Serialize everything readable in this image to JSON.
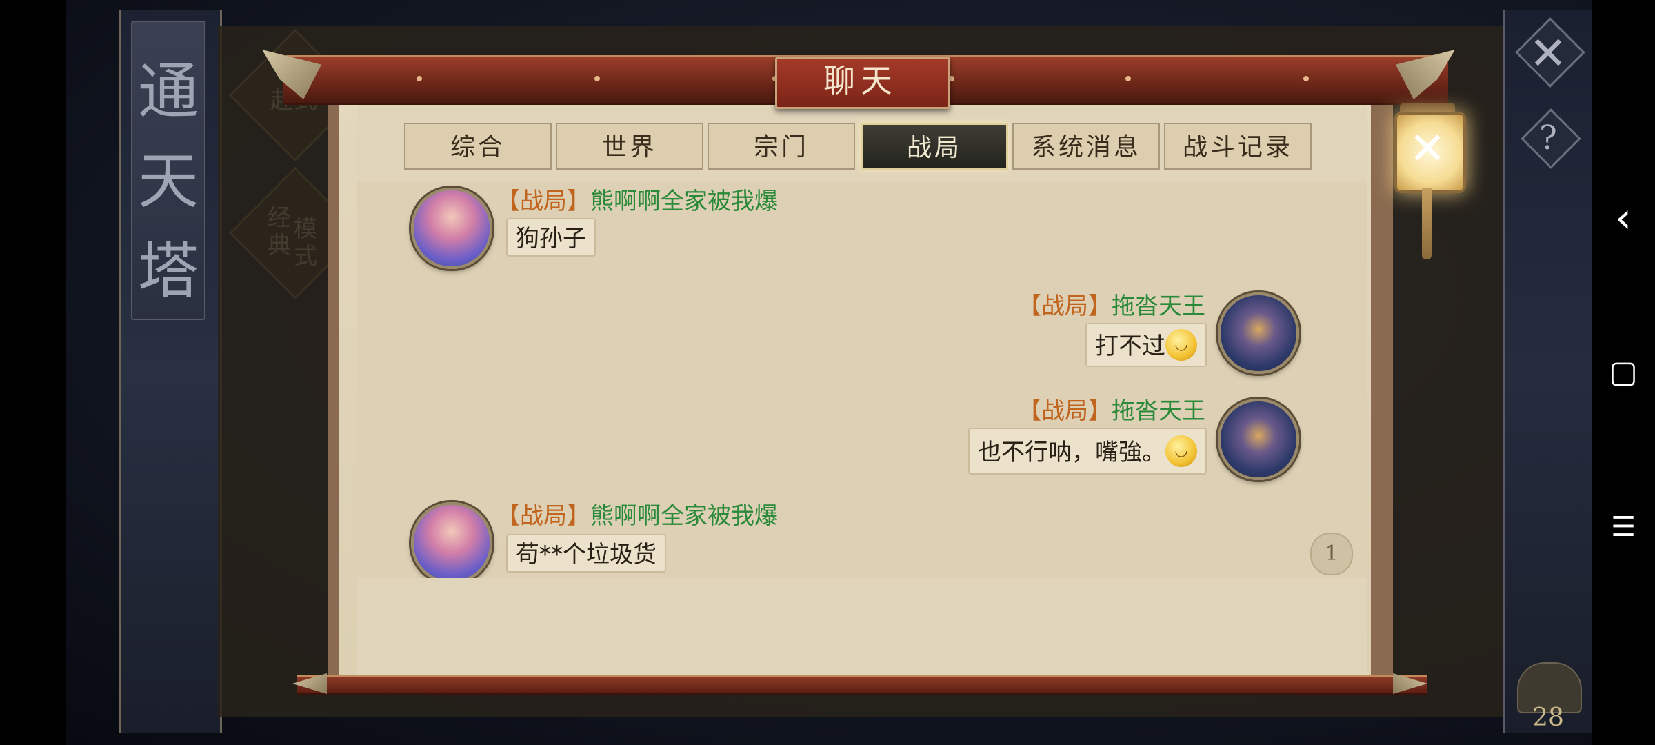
{
  "window": {
    "title": "聊天"
  },
  "background": {
    "left_banner_chars": [
      "通",
      "天",
      "塔"
    ],
    "mode_top_text": "赴式",
    "mode_classic_text_a": "经典",
    "mode_classic_text_b": "模式",
    "right_close_glyph": "✕",
    "right_help_glyph": "?",
    "bottom_count": "28"
  },
  "tabs": [
    {
      "label": "综合",
      "active": false
    },
    {
      "label": "世界",
      "active": false
    },
    {
      "label": "宗门",
      "active": false
    },
    {
      "label": "战局",
      "active": true
    },
    {
      "label": "系统消息",
      "active": false
    },
    {
      "label": "战斗记录",
      "active": false
    }
  ],
  "messages": [
    {
      "side": "left",
      "avatar": "female-hero-avatar",
      "channel": "【战局】",
      "sender": "熊啊啊全家被我爆",
      "text": "狗孙子",
      "emoji": false
    },
    {
      "side": "right",
      "avatar": "male-hero-avatar",
      "channel": "【战局】",
      "sender": "拖沓天王",
      "text": "打不过",
      "emoji": true
    },
    {
      "side": "right",
      "avatar": "male-hero-avatar",
      "channel": "【战局】",
      "sender": "拖沓天王",
      "text": "也不行呐，嘴強。",
      "emoji": true
    },
    {
      "side": "left",
      "avatar": "female-hero-avatar",
      "channel": "【战局】",
      "sender": "熊啊啊全家被我爆",
      "text": "苟**个垃圾货",
      "emoji": false
    }
  ],
  "unread_count": "1",
  "lantern_close_glyph": "✕",
  "android_nav": {
    "back": "‹",
    "home": "▢",
    "menu": "☰"
  },
  "colors": {
    "channel_tag": "#c0641e",
    "sender_name": "#2a8a3a",
    "active_tab_bg": "#2e2e28",
    "title_plate": "#8a2c1c"
  }
}
